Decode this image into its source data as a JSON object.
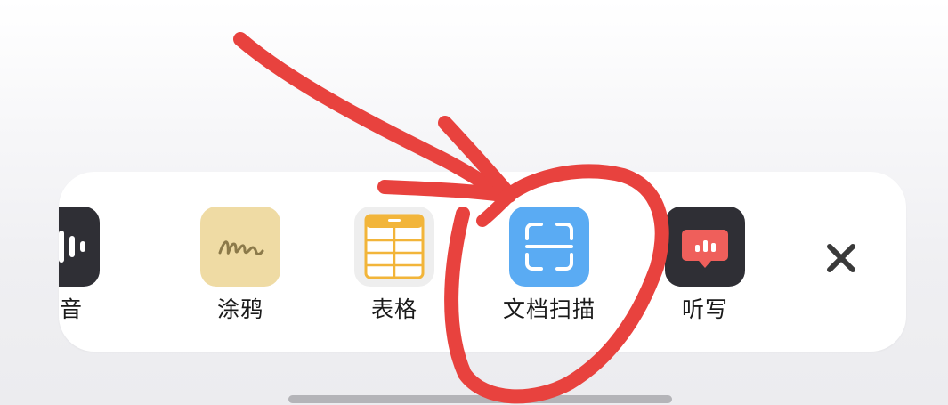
{
  "toolbar": {
    "items": [
      {
        "label": "录音",
        "icon": "voice-record-icon"
      },
      {
        "label": "涂鸦",
        "icon": "doodle-icon"
      },
      {
        "label": "表格",
        "icon": "table-icon"
      },
      {
        "label": "文档扫描",
        "icon": "document-scan-icon"
      },
      {
        "label": "听写",
        "icon": "dictation-icon"
      }
    ],
    "close_icon": "close-icon"
  },
  "annotation": {
    "color": "#e8423e",
    "shapes": [
      "arrow-pointer",
      "circle-highlight"
    ]
  },
  "colors": {
    "record_bg": "#2f2f35",
    "doodle_bg": "#efdba4",
    "table_bg": "#eeeeee",
    "table_accent": "#f2b53a",
    "scan_bg": "#5aabf3",
    "dictation_bg": "#2f2f35",
    "dictation_bubble": "#ef5f5b"
  }
}
